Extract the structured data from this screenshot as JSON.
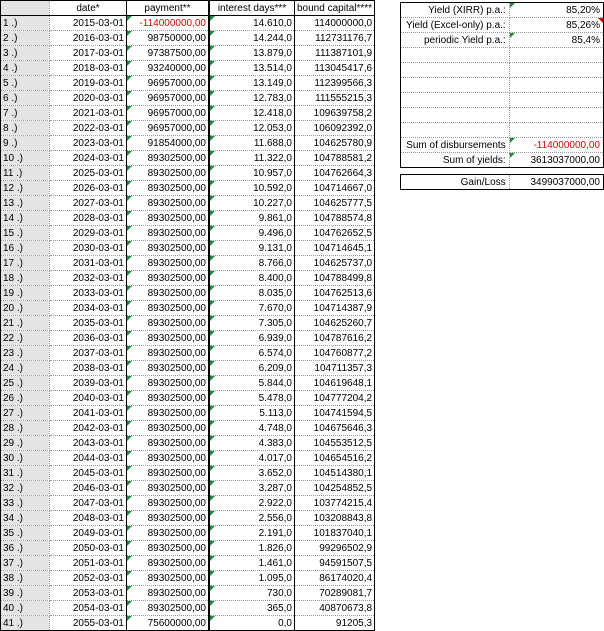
{
  "headers": {
    "index": "",
    "date": "date*",
    "payment": "payment**",
    "interest_days": "interest days***",
    "bound_capital": "bound capital****"
  },
  "rows": [
    {
      "idx": "1 .)",
      "date": "2015-03-01",
      "payment": "-114000000,00",
      "days": "14.610,0",
      "capital": "114000000,0"
    },
    {
      "idx": "2 .)",
      "date": "2016-03-01",
      "payment": "98750000,00",
      "days": "14.244,0",
      "capital": "112731176,7"
    },
    {
      "idx": "3 .)",
      "date": "2017-03-01",
      "payment": "97387500,00",
      "days": "13.879,0",
      "capital": "111387101,9"
    },
    {
      "idx": "4 .)",
      "date": "2018-03-01",
      "payment": "93240000,00",
      "days": "13.514,0",
      "capital": "113045417,6"
    },
    {
      "idx": "5 .)",
      "date": "2019-03-01",
      "payment": "96957000,00",
      "days": "13.149,0",
      "capital": "112399566,3"
    },
    {
      "idx": "6 .)",
      "date": "2020-03-01",
      "payment": "96957000,00",
      "days": "12.783,0",
      "capital": "111555215,3"
    },
    {
      "idx": "7 .)",
      "date": "2021-03-01",
      "payment": "96957000,00",
      "days": "12.418,0",
      "capital": "109639758,2"
    },
    {
      "idx": "8 .)",
      "date": "2022-03-01",
      "payment": "96957000,00",
      "days": "12.053,0",
      "capital": "106092392,0"
    },
    {
      "idx": "9 .)",
      "date": "2023-03-01",
      "payment": "91854000,00",
      "days": "11.688,0",
      "capital": "104625780,9"
    },
    {
      "idx": "10 .)",
      "date": "2024-03-01",
      "payment": "89302500,00",
      "days": "11.322,0",
      "capital": "104788581,2"
    },
    {
      "idx": "11 .)",
      "date": "2025-03-01",
      "payment": "89302500,00",
      "days": "10.957,0",
      "capital": "104762664,3"
    },
    {
      "idx": "12 .)",
      "date": "2026-03-01",
      "payment": "89302500,00",
      "days": "10.592,0",
      "capital": "104714667,0"
    },
    {
      "idx": "13 .)",
      "date": "2027-03-01",
      "payment": "89302500,00",
      "days": "10.227,0",
      "capital": "104625777,5"
    },
    {
      "idx": "14 .)",
      "date": "2028-03-01",
      "payment": "89302500,00",
      "days": "9.861,0",
      "capital": "104788574,8"
    },
    {
      "idx": "15 .)",
      "date": "2029-03-01",
      "payment": "89302500,00",
      "days": "9.496,0",
      "capital": "104762652,5"
    },
    {
      "idx": "16 .)",
      "date": "2030-03-01",
      "payment": "89302500,00",
      "days": "9.131,0",
      "capital": "104714645,1"
    },
    {
      "idx": "17 .)",
      "date": "2031-03-01",
      "payment": "89302500,00",
      "days": "8.766,0",
      "capital": "104625737,0"
    },
    {
      "idx": "18 .)",
      "date": "2032-03-01",
      "payment": "89302500,00",
      "days": "8.400,0",
      "capital": "104788499,8"
    },
    {
      "idx": "19 .)",
      "date": "2033-03-01",
      "payment": "89302500,00",
      "days": "8.035,0",
      "capital": "104762513,6"
    },
    {
      "idx": "20 .)",
      "date": "2034-03-01",
      "payment": "89302500,00",
      "days": "7.670,0",
      "capital": "104714387,9"
    },
    {
      "idx": "21 .)",
      "date": "2035-03-01",
      "payment": "89302500,00",
      "days": "7.305,0",
      "capital": "104625260,7"
    },
    {
      "idx": "22 .)",
      "date": "2036-03-01",
      "payment": "89302500,00",
      "days": "6.939,0",
      "capital": "104787616,2"
    },
    {
      "idx": "23 .)",
      "date": "2037-03-01",
      "payment": "89302500,00",
      "days": "6.574,0",
      "capital": "104760877,2"
    },
    {
      "idx": "24 .)",
      "date": "2038-03-01",
      "payment": "89302500,00",
      "days": "6.209,0",
      "capital": "104711357,3"
    },
    {
      "idx": "25 .)",
      "date": "2039-03-01",
      "payment": "89302500,00",
      "days": "5.844,0",
      "capital": "104619648,1"
    },
    {
      "idx": "26 .)",
      "date": "2040-03-01",
      "payment": "89302500,00",
      "days": "5.478,0",
      "capital": "104777204,2"
    },
    {
      "idx": "27 .)",
      "date": "2041-03-01",
      "payment": "89302500,00",
      "days": "5.113,0",
      "capital": "104741594,5"
    },
    {
      "idx": "28 .)",
      "date": "2042-03-01",
      "payment": "89302500,00",
      "days": "4.748,0",
      "capital": "104675646,3"
    },
    {
      "idx": "29 .)",
      "date": "2043-03-01",
      "payment": "89302500,00",
      "days": "4.383,0",
      "capital": "104553512,5"
    },
    {
      "idx": "30 .)",
      "date": "2044-03-01",
      "payment": "89302500,00",
      "days": "4.017,0",
      "capital": "104654516,2"
    },
    {
      "idx": "31 .)",
      "date": "2045-03-01",
      "payment": "89302500,00",
      "days": "3.652,0",
      "capital": "104514380,1"
    },
    {
      "idx": "32 .)",
      "date": "2046-03-01",
      "payment": "89302500,00",
      "days": "3.287,0",
      "capital": "104254852,5"
    },
    {
      "idx": "33 .)",
      "date": "2047-03-01",
      "payment": "89302500,00",
      "days": "2.922,0",
      "capital": "103774215,4"
    },
    {
      "idx": "34 .)",
      "date": "2048-03-01",
      "payment": "89302500,00",
      "days": "2.556,0",
      "capital": "103208843,8"
    },
    {
      "idx": "35 .)",
      "date": "2049-03-01",
      "payment": "89302500,00",
      "days": "2.191,0",
      "capital": "101837040,1"
    },
    {
      "idx": "36 .)",
      "date": "2050-03-01",
      "payment": "89302500,00",
      "days": "1.826,0",
      "capital": "99296502,9"
    },
    {
      "idx": "37 .)",
      "date": "2051-03-01",
      "payment": "89302500,00",
      "days": "1.461,0",
      "capital": "94591507,5"
    },
    {
      "idx": "38 .)",
      "date": "2052-03-01",
      "payment": "89302500,00",
      "days": "1.095,0",
      "capital": "86174020,4"
    },
    {
      "idx": "39 .)",
      "date": "2053-03-01",
      "payment": "89302500,00",
      "days": "730,0",
      "capital": "70289081,7"
    },
    {
      "idx": "40 .)",
      "date": "2054-03-01",
      "payment": "89302500,00",
      "days": "365,0",
      "capital": "40870673,8"
    },
    {
      "idx": "41 .)",
      "date": "2055-03-01",
      "payment": "75600000,00",
      "days": "0,0",
      "capital": "91205,3"
    }
  ],
  "summary": {
    "xirr_label": "Yield (XIRR) p.a.:",
    "xirr_value": "85,20%",
    "excel_label": "Yield (Excel-only) p.a.:",
    "excel_value": "85,26%",
    "periodic_label": "periodic Yield p.a.:",
    "periodic_value": "85,4%",
    "disb_label": "Sum of disbursements",
    "disb_value": "-114000000,00",
    "yields_label": "Sum of  yields:",
    "yields_value": "3613037000,00",
    "gain_label": "Gain/Loss",
    "gain_value": "3499037000,00"
  },
  "colors": {
    "negative": "#e00000",
    "comment_marker": "#1a8c3a",
    "error_marker": "#d00000",
    "gridline": "#9a9a9a"
  }
}
